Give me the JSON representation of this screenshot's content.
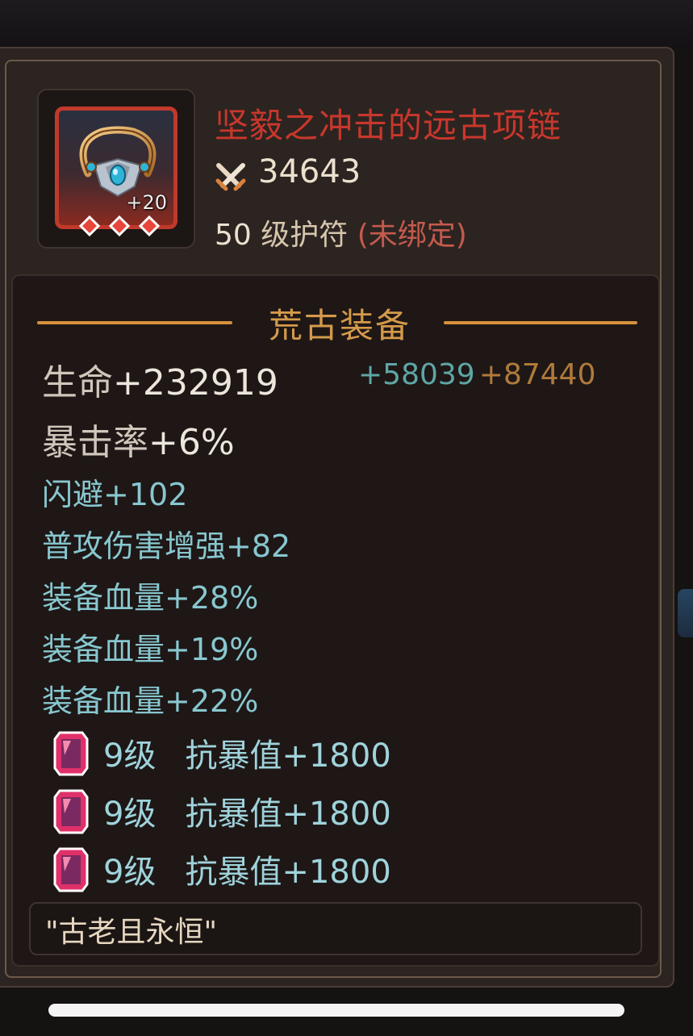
{
  "item": {
    "name": "坚毅之冲击的远古项链",
    "enhance": "+20",
    "power": "34643",
    "level_num": "50",
    "level_text": " 级护符 ",
    "bind_status": "(未绑定)",
    "icon": "necklace-icon",
    "power_icon": "crossed-swords-icon",
    "stars": 3,
    "rarity_color": "#c0392b"
  },
  "section": {
    "title": "荒古装备",
    "main_stats": [
      {
        "label": "生命",
        "value": "+232919",
        "bonus1": "+58039",
        "bonus2": "+87440"
      },
      {
        "label": "暴击率",
        "value": "+6%"
      }
    ],
    "sub_stats": [
      "闪避+102",
      "普攻伤害增强+82",
      "装备血量+28%",
      "装备血量+19%",
      "装备血量+22%"
    ],
    "gems": [
      {
        "level": "9级",
        "attr": "抗暴值+1800"
      },
      {
        "level": "9级",
        "attr": "抗暴值+1800"
      },
      {
        "level": "9级",
        "attr": "抗暴值+1800"
      }
    ],
    "gem_icon": "pink-gem-icon"
  },
  "flavor_text": "\"古老且永恒\"",
  "colors": {
    "name": "#c8372c",
    "section_title": "#d49a4a",
    "sub_stat": "#88c7cf",
    "bonus1": "#5fa6a6",
    "bonus2": "#b07a3a"
  }
}
